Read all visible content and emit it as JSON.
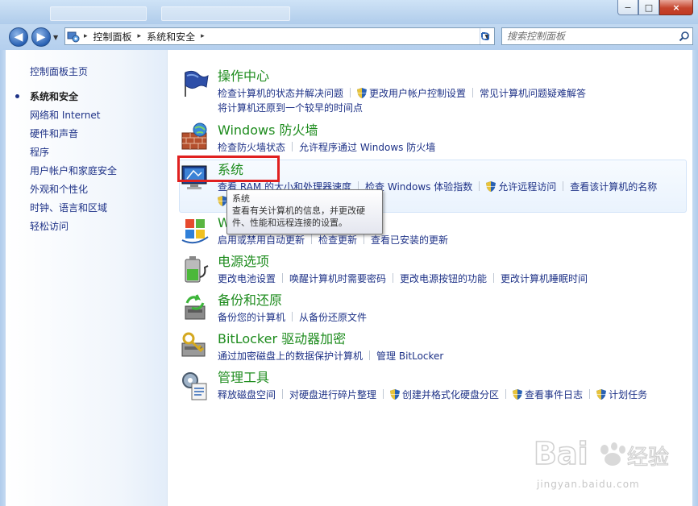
{
  "window": {
    "title": "",
    "controls": {
      "minimize": "−",
      "maximize": "□",
      "close": "×"
    }
  },
  "address": {
    "crumbs": [
      "控制面板",
      "系统和安全"
    ]
  },
  "search": {
    "placeholder": "搜索控制面板"
  },
  "sidebar": {
    "home": "控制面板主页",
    "items": [
      {
        "label": "系统和安全",
        "active": true
      },
      {
        "label": "网络和 Internet"
      },
      {
        "label": "硬件和声音"
      },
      {
        "label": "程序"
      },
      {
        "label": "用户帐户和家庭安全"
      },
      {
        "label": "外观和个性化"
      },
      {
        "label": "时钟、语言和区域"
      },
      {
        "label": "轻松访问"
      }
    ]
  },
  "categories": [
    {
      "title": "操作中心",
      "icon": "action-center-flag-icon",
      "links": [
        "检查计算机的状态并解决问题",
        "更改用户帐户控制设置",
        "常见计算机问题疑难解答",
        "将计算机还原到一个较早的时间点"
      ]
    },
    {
      "title": "Windows 防火墙",
      "icon": "firewall-icon",
      "links": [
        "检查防火墙状态",
        "允许程序通过 Windows 防火墙"
      ]
    },
    {
      "title": "系统",
      "icon": "system-icon",
      "links": [
        "查看 RAM 的大小和处理器速度",
        "检查 Windows 体验指数",
        "允许远程访问",
        "查看该计算机的名称"
      ]
    },
    {
      "title": "W",
      "icon": "windows-update-icon",
      "links": [
        "启用或禁用自动更新",
        "检查更新",
        "查看已安装的更新"
      ]
    },
    {
      "title": "电源选项",
      "icon": "power-options-icon",
      "links": [
        "更改电池设置",
        "唤醒计算机时需要密码",
        "更改电源按钮的功能",
        "更改计算机睡眠时间"
      ]
    },
    {
      "title": "备份和还原",
      "icon": "backup-restore-icon",
      "links": [
        "备份您的计算机",
        "从备份还原文件"
      ]
    },
    {
      "title": "BitLocker 驱动器加密",
      "icon": "bitlocker-icon",
      "links": [
        "通过加密磁盘上的数据保护计算机",
        "管理 BitLocker"
      ]
    },
    {
      "title": "管理工具",
      "icon": "admin-tools-icon",
      "links": [
        "释放磁盘空间",
        "对硬盘进行碎片整理",
        "创建并格式化硬盘分区",
        "查看事件日志",
        "计划任务"
      ]
    }
  ],
  "tooltip": {
    "title": "系统",
    "body": "查看有关计算机的信息，并更改硬件、性能和远程连接的设置。"
  },
  "watermark": {
    "text": "jingyan.baidu.com",
    "logo": "Baidu经验"
  },
  "colors": {
    "link": "#1e3287",
    "category_title": "#1e8c1e",
    "highlight": "#e0201f",
    "chrome": "#b4cfee"
  }
}
